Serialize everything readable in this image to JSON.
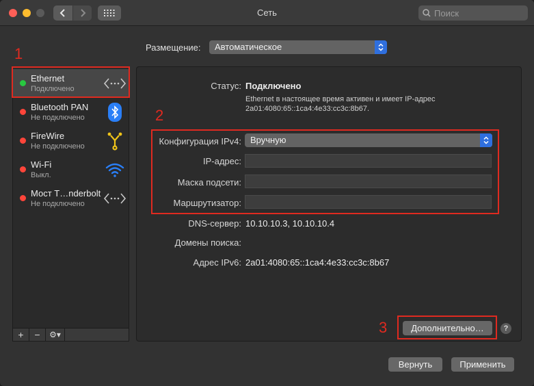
{
  "window": {
    "title": "Сеть"
  },
  "search": {
    "placeholder": "Поиск"
  },
  "placement": {
    "label": "Размещение:",
    "value": "Автоматическое"
  },
  "services": [
    {
      "name": "Ethernet",
      "status": "Подключено",
      "status_color": "#28c840",
      "icon": "ethernet-arrows-icon"
    },
    {
      "name": "Bluetooth PAN",
      "status": "Не подключено",
      "status_color": "#ff453a",
      "icon": "bluetooth-icon"
    },
    {
      "name": "FireWire",
      "status": "Не подключено",
      "status_color": "#ff453a",
      "icon": "firewire-icon"
    },
    {
      "name": "Wi-Fi",
      "status": "Выкл.",
      "status_color": "#ff453a",
      "icon": "wifi-icon"
    },
    {
      "name": "Мост T…nderbolt",
      "status": "Не подключено",
      "status_color": "#ff453a",
      "icon": "thunderbolt-bridge-arrows-icon"
    }
  ],
  "sidebar_tools": {
    "add": "+",
    "remove": "−",
    "gear": "⚙▾"
  },
  "detail": {
    "status_label": "Статус:",
    "status_value": "Подключено",
    "status_desc_line1": "Ethernet в настоящее время активен и имеет IP-адрес",
    "status_desc_line2": "2a01:4080:65::1ca4:4e33:cc3c:8b67.",
    "ipv4_config_label": "Конфигурация IPv4:",
    "ipv4_config_value": "Вручную",
    "ip_label": "IP-адрес:",
    "ip_value": "",
    "mask_label": "Маска подсети:",
    "mask_value": "",
    "router_label": "Маршрутизатор:",
    "router_value": "",
    "dns_label": "DNS-сервер:",
    "dns_value": "10.10.10.3, 10.10.10.4",
    "search_domains_label": "Домены поиска:",
    "ipv6_label": "Адрес IPv6:",
    "ipv6_value": "2a01:4080:65::1ca4:4e33:cc3c:8b67"
  },
  "buttons": {
    "advanced": "Дополнительно…",
    "revert": "Вернуть",
    "apply": "Применить",
    "help": "?"
  },
  "annotations": {
    "marker1": "1",
    "marker2": "2",
    "marker3": "3",
    "color": "#e02a20"
  }
}
